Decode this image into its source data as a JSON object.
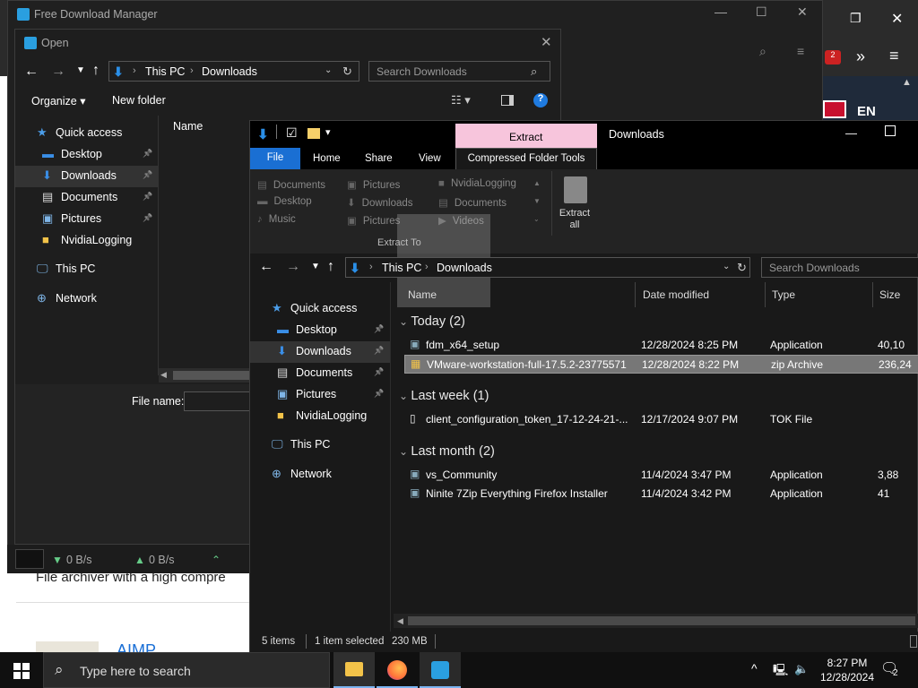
{
  "desktop_window": {
    "lang": "EN",
    "badge": "2"
  },
  "web": {
    "line1": "File archiver with a high compre",
    "line2": "AIMP"
  },
  "fdm": {
    "title": "Free Download Manager",
    "status_down": "0 B/s",
    "status_up": "0 B/s"
  },
  "open_dialog": {
    "title": "Open",
    "breadcrumb": [
      "This PC",
      "Downloads"
    ],
    "search_placeholder": "Search Downloads",
    "organize": "Organize",
    "new_folder": "New folder",
    "nav": [
      {
        "label": "Quick access",
        "icon": "star-icon"
      },
      {
        "label": "Desktop",
        "icon": "desktop-icon",
        "pinned": true
      },
      {
        "label": "Downloads",
        "icon": "download-icon",
        "pinned": true
      },
      {
        "label": "Documents",
        "icon": "document-icon",
        "pinned": true
      },
      {
        "label": "Pictures",
        "icon": "picture-icon",
        "pinned": true
      },
      {
        "label": "NvidiaLogging",
        "icon": "folder-icon"
      },
      {
        "label": "This PC",
        "icon": "pc-icon"
      },
      {
        "label": "Network",
        "icon": "network-icon"
      }
    ],
    "column_name": "Name",
    "file_name_label": "File name:"
  },
  "explorer": {
    "contextual_tab": "Extract",
    "title": "Downloads",
    "tabs": [
      "File",
      "Home",
      "Share",
      "View",
      "Compressed Folder Tools"
    ],
    "extract_to_items": [
      [
        "Documents",
        "Pictures",
        "NvidiaLogging"
      ],
      [
        "Desktop",
        "Downloads",
        "Documents"
      ],
      [
        "Music",
        "Pictures",
        "Videos"
      ]
    ],
    "extract_to_label": "Extract To",
    "extract_all": "Extract all",
    "breadcrumb": [
      "This PC",
      "Downloads"
    ],
    "search_placeholder": "Search Downloads",
    "nav": [
      {
        "label": "Quick access",
        "icon": "star-icon"
      },
      {
        "label": "Desktop",
        "icon": "desktop-icon",
        "pinned": true
      },
      {
        "label": "Downloads",
        "icon": "download-icon",
        "pinned": true
      },
      {
        "label": "Documents",
        "icon": "document-icon",
        "pinned": true
      },
      {
        "label": "Pictures",
        "icon": "picture-icon",
        "pinned": true
      },
      {
        "label": "NvidiaLogging",
        "icon": "folder-icon"
      },
      {
        "label": "This PC",
        "icon": "pc-icon"
      },
      {
        "label": "Network",
        "icon": "network-icon"
      }
    ],
    "columns": [
      "Name",
      "Date modified",
      "Type",
      "Size"
    ],
    "groups": [
      {
        "label": "Today (2)",
        "files": [
          {
            "name": "fdm_x64_setup",
            "date": "12/28/2024 8:25 PM",
            "type": "Application",
            "size": "40,10"
          },
          {
            "name": "VMware-workstation-full-17.5.2-23775571",
            "date": "12/28/2024 8:22 PM",
            "type": "zip Archive",
            "size": "236,24"
          }
        ]
      },
      {
        "label": "Last week (1)",
        "files": [
          {
            "name": "client_configuration_token_17-12-24-21-...",
            "date": "12/17/2024 9:07 PM",
            "type": "TOK File",
            "size": ""
          }
        ]
      },
      {
        "label": "Last month (2)",
        "files": [
          {
            "name": "vs_Community",
            "date": "11/4/2024 3:47 PM",
            "type": "Application",
            "size": "3,88"
          },
          {
            "name": "Ninite 7Zip Everything Firefox Installer",
            "date": "11/4/2024 3:42 PM",
            "type": "Application",
            "size": "41"
          }
        ]
      }
    ],
    "status": {
      "items": "5 items",
      "selected": "1 item selected",
      "size": "230 MB"
    }
  },
  "taskbar": {
    "search_placeholder": "Type here to search",
    "time": "8:27 PM",
    "date": "12/28/2024",
    "notification_count": "2"
  },
  "colors": {
    "accent": "#0078d7",
    "extract_tab": "#f7c5dc",
    "selected_row": "#777777"
  }
}
